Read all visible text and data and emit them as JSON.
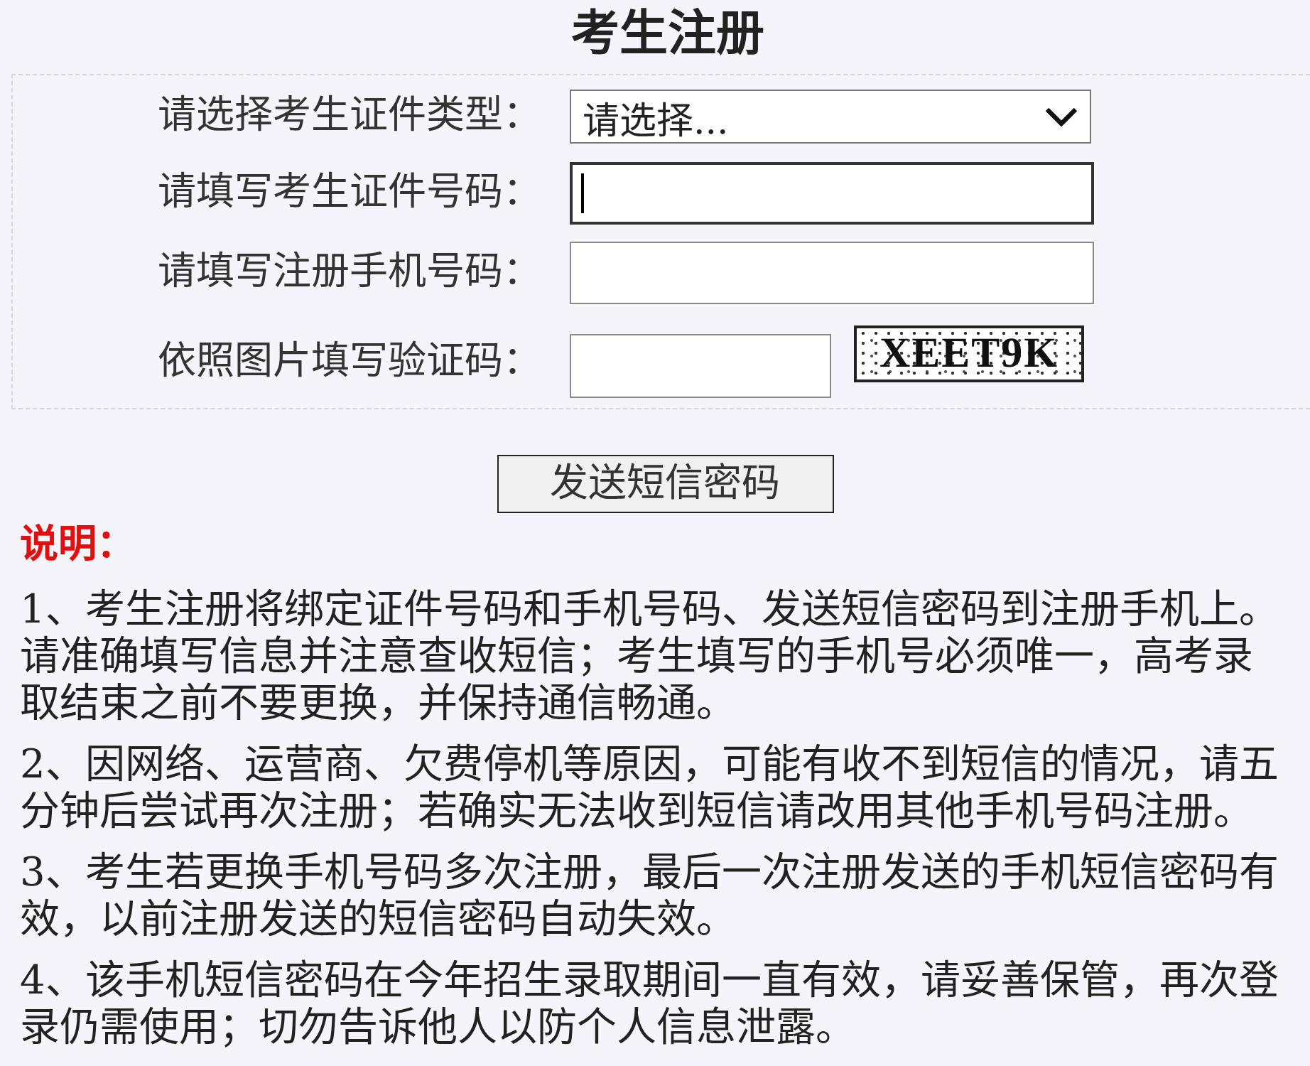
{
  "title": "考生注册",
  "form": {
    "fields": [
      {
        "kind": "select",
        "label": "请选择考生证件类型：",
        "value": "请选择...",
        "focused": false
      },
      {
        "kind": "input",
        "label": "请填写考生证件号码：",
        "focused": true
      },
      {
        "kind": "input",
        "label": "请填写注册手机号码：",
        "focused": false
      },
      {
        "kind": "captcha",
        "label": "依照图片填写验证码：",
        "focused": false,
        "captcha": "XEET9K"
      }
    ]
  },
  "send_button": "发送短信密码",
  "notes": {
    "heading": "说明：",
    "items": [
      "1、考生注册将绑定证件号码和手机号码、发送短信密码到注册手机上。请准确填写信息并注意查收短信；考生填写的手机号必须唯一，高考录取结束之前不要更换，并保持通信畅通。",
      "2、因网络、运营商、欠费停机等原因，可能有收不到短信的情况，请五分钟后尝试再次注册；若确实无法收到短信请改用其他手机号码注册。",
      "3、考生若更换手机号码多次注册，最后一次注册发送的手机短信密码有效，以前注册发送的短信密码自动失效。",
      "4、该手机短信密码在今年招生录取期间一直有效，请妥善保管，再次登录仍需使用；切勿告诉他人以防个人信息泄露。"
    ]
  }
}
